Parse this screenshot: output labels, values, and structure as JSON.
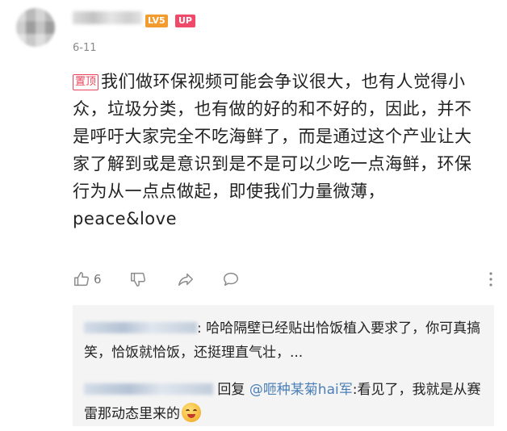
{
  "comment": {
    "level_badge": "LV5",
    "up_badge": "UP",
    "date": "6-11",
    "pin_label": "置顶",
    "text": "我们做环保视频可能会争议很大，也有人觉得小众，垃圾分类，也有做的好的和不好的，因此，并不是呼吁大家完全不吃海鲜了，而是通过这个产业让大家了解到或是意识到是不是可以少吃一点海鲜，环保行为从一点点做起，即使我们力量微薄，",
    "text_end": "peace&love",
    "like_count": "6",
    "icons": [
      "thumbs-up-icon",
      "thumbs-down-icon",
      "share-icon",
      "reply-bubble-icon",
      "more-vertical-icon"
    ]
  },
  "replies": [
    {
      "separator": ":",
      "text": "哈哈隔壁已经贴出恰饭植入要求了，你可真搞笑，恰饭就恰饭，还挺理直气壮，..."
    },
    {
      "reply_label": "回复",
      "mention": "@咂种某菊hai军",
      "text": ":看见了，我就是从赛雷那动态里来的",
      "emoji": "grinning-face-emoji"
    }
  ]
}
